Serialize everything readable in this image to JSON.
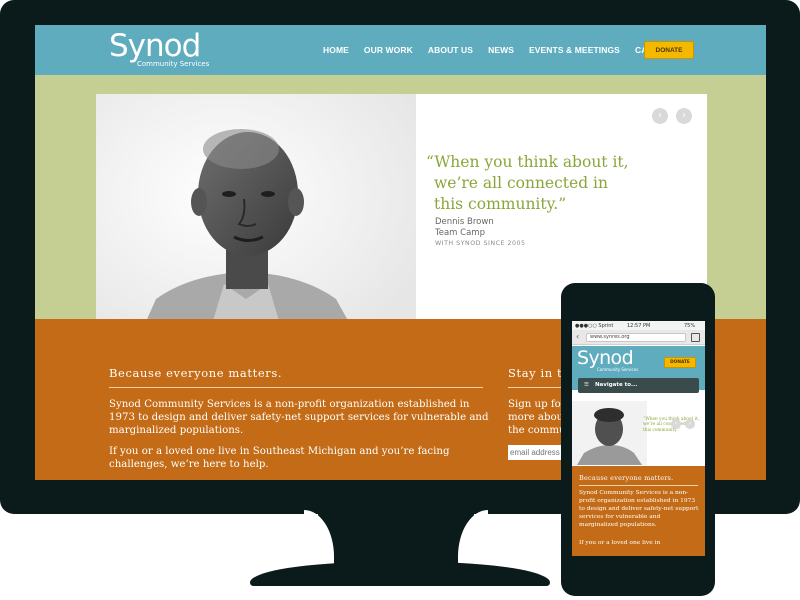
{
  "desktop": {
    "logo": {
      "word": "Synod",
      "sub": "Community Services"
    },
    "nav": [
      "HOME",
      "OUR WORK",
      "ABOUT US",
      "NEWS",
      "EVENTS & MEETINGS",
      "CAREERS"
    ],
    "donate_label": "DONATE",
    "hero": {
      "quote_lines": [
        "“When you think about it,",
        "we’re all connected in",
        "this community.”"
      ],
      "author": "Dennis Brown",
      "team": "Team Camp",
      "since": "WITH SYNOD SINCE 2005",
      "prev_icon": "arrow-left-icon",
      "next_icon": "arrow-right-icon"
    },
    "about": {
      "heading": "Because everyone matters.",
      "p1": "Synod Community Services is a non-profit organization established in 1973 to design and deliver safety-net support services for vulnerable and marginalized populations.",
      "p2": "If you or a loved one live in Southeast Michigan and you’re facing challenges, we’re here to help."
    },
    "signup": {
      "heading": "Stay in t",
      "lines": [
        "Sign up for",
        "more about",
        "the commu"
      ],
      "email_placeholder": "email address"
    }
  },
  "mobile": {
    "status": {
      "carrier": "●●●○○ Sprint",
      "time": "12:57 PM",
      "battery": "75%"
    },
    "url": "www.synres.org",
    "logo": {
      "word": "Synod",
      "sub": "Community Services"
    },
    "donate_label": "DONATE",
    "nav_label": "Navigate to...",
    "hero_quote_lines": [
      "“When you think about it,",
      "we’re all connected in",
      "this community.”"
    ],
    "about": {
      "heading": "Because everyone matters.",
      "p1": "Synod Community Services is a non-profit organization established in 1973 to design and deliver safety-net support services for vulnerable and marginalized populations.",
      "p2": "If you or a loved one live in"
    }
  },
  "colors": {
    "header_teal": "#5facbf",
    "band_green": "#c5cf93",
    "band_orange": "#c36b16",
    "quote_green": "#8aa63b",
    "donate_yellow": "#f5b800",
    "device_dark": "#0b1a1a"
  }
}
